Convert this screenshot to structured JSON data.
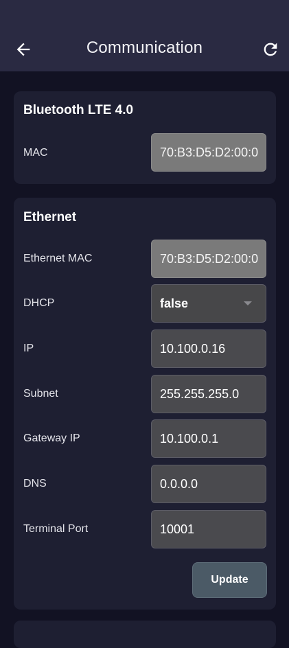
{
  "header": {
    "title": "Communication",
    "back_icon": "arrow-left-icon",
    "refresh_icon": "refresh-icon"
  },
  "bluetooth": {
    "title": "Bluetooth LTE 4.0",
    "mac_label": "MAC",
    "mac_value": "70:B3:D5:D2:00:0"
  },
  "ethernet": {
    "title": "Ethernet",
    "mac_label": "Ethernet MAC",
    "mac_value": "70:B3:D5:D2:00:0",
    "dhcp_label": "DHCP",
    "dhcp_value": "false",
    "ip_label": "IP",
    "ip_value": "10.100.0.16",
    "subnet_label": "Subnet",
    "subnet_value": "255.255.255.0",
    "gateway_label": "Gateway IP",
    "gateway_value": "10.100.0.1",
    "dns_label": "DNS",
    "dns_value": "0.0.0.0",
    "port_label": "Terminal Port",
    "port_value": "10001",
    "update_label": "Update"
  },
  "colors": {
    "background": "#121223",
    "appbar": "#2a2a42",
    "card": "#1e1f32",
    "readonly_field": "#7a7a7a",
    "editable_field": "#4a4a4e",
    "update_button": "#4b5a66"
  }
}
